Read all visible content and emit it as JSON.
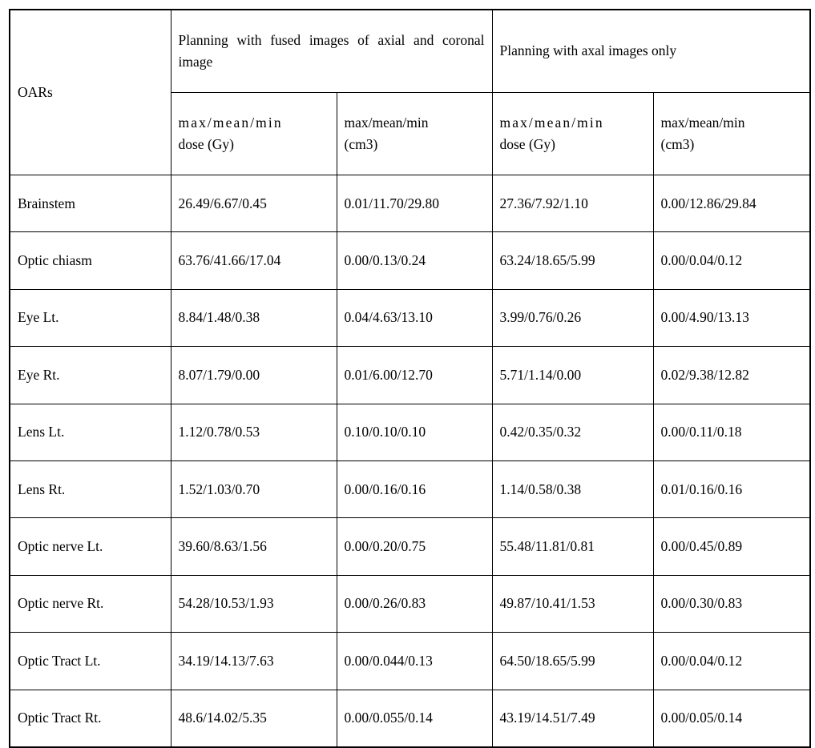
{
  "table": {
    "row_label_header": "OARs",
    "group_headers": [
      "Planning with fused images of axial and coronal image",
      "Planning with axal images only"
    ],
    "sub_headers": [
      {
        "line1": "max/mean/min",
        "line2": "dose (Gy)"
      },
      {
        "line1": "max/mean/min",
        "line2": "(cm3)"
      },
      {
        "line1": "max/mean/min",
        "line2": "dose (Gy)"
      },
      {
        "line1": "max/mean/min",
        "line2": "(cm3)"
      }
    ],
    "rows": [
      {
        "oar": "Brainstem",
        "fused_dose": "26.49/6.67/0.45",
        "fused_vol": "0.01/11.70/29.80",
        "axial_dose": "27.36/7.92/1.10",
        "axial_vol": "0.00/12.86/29.84"
      },
      {
        "oar": "Optic chiasm",
        "fused_dose": "63.76/41.66/17.04",
        "fused_vol": "0.00/0.13/0.24",
        "axial_dose": "63.24/18.65/5.99",
        "axial_vol": "0.00/0.04/0.12"
      },
      {
        "oar": "Eye Lt.",
        "fused_dose": "8.84/1.48/0.38",
        "fused_vol": "0.04/4.63/13.10",
        "axial_dose": "3.99/0.76/0.26",
        "axial_vol": "0.00/4.90/13.13"
      },
      {
        "oar": "Eye Rt.",
        "fused_dose": "8.07/1.79/0.00",
        "fused_vol": "0.01/6.00/12.70",
        "axial_dose": "5.71/1.14/0.00",
        "axial_vol": "0.02/9.38/12.82"
      },
      {
        "oar": "Lens Lt.",
        "fused_dose": "1.12/0.78/0.53",
        "fused_vol": "0.10/0.10/0.10",
        "axial_dose": "0.42/0.35/0.32",
        "axial_vol": "0.00/0.11/0.18"
      },
      {
        "oar": "Lens Rt.",
        "fused_dose": "1.52/1.03/0.70",
        "fused_vol": "0.00/0.16/0.16",
        "axial_dose": "1.14/0.58/0.38",
        "axial_vol": "0.01/0.16/0.16"
      },
      {
        "oar": "Optic nerve Lt.",
        "fused_dose": "39.60/8.63/1.56",
        "fused_vol": "0.00/0.20/0.75",
        "axial_dose": "55.48/11.81/0.81",
        "axial_vol": "0.00/0.45/0.89"
      },
      {
        "oar": "Optic nerve Rt.",
        "fused_dose": "54.28/10.53/1.93",
        "fused_vol": "0.00/0.26/0.83",
        "axial_dose": "49.87/10.41/1.53",
        "axial_vol": "0.00/0.30/0.83"
      },
      {
        "oar": "Optic Tract Lt.",
        "fused_dose": "34.19/14.13/7.63",
        "fused_vol": "0.00/0.044/0.13",
        "axial_dose": "64.50/18.65/5.99",
        "axial_vol": "0.00/0.04/0.12"
      },
      {
        "oar": "Optic Tract Rt.",
        "fused_dose": "48.6/14.02/5.35",
        "fused_vol": "0.00/0.055/0.14",
        "axial_dose": "43.19/14.51/7.49",
        "axial_vol": "0.00/0.05/0.14"
      }
    ]
  },
  "colors": {
    "border": "#000000",
    "text": "#000000",
    "background": "#ffffff"
  }
}
